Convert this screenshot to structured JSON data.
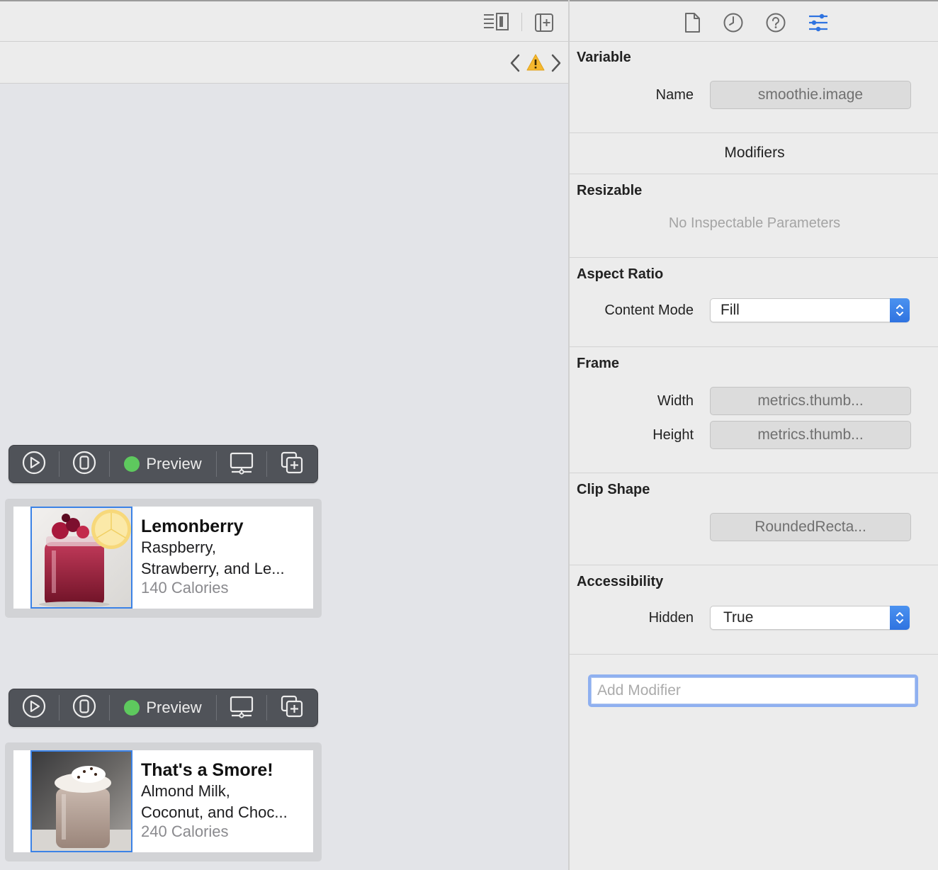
{
  "canvas": {
    "previews": [
      {
        "preview_label": "Preview",
        "title": "Lemonberry",
        "line1": "Raspberry,",
        "line2": "Strawberry, and Le...",
        "calories": "140 Calories"
      },
      {
        "preview_label": "Preview",
        "title": "That's a Smore!",
        "line1": "Almond Milk,",
        "line2": "Coconut, and Choc...",
        "calories": "240 Calories"
      }
    ]
  },
  "inspector": {
    "variable": {
      "title": "Variable",
      "name_label": "Name",
      "name_value": "smoothie.image"
    },
    "modifiers_header": "Modifiers",
    "resizable": {
      "title": "Resizable",
      "empty_text": "No Inspectable Parameters"
    },
    "aspect_ratio": {
      "title": "Aspect Ratio",
      "content_mode_label": "Content Mode",
      "content_mode_value": "Fill"
    },
    "frame": {
      "title": "Frame",
      "width_label": "Width",
      "width_value": "metrics.thumb...",
      "height_label": "Height",
      "height_value": "metrics.thumb..."
    },
    "clip_shape": {
      "title": "Clip Shape",
      "value": "RoundedRecta..."
    },
    "accessibility": {
      "title": "Accessibility",
      "hidden_label": "Hidden",
      "hidden_value": "True"
    },
    "add_modifier_placeholder": "Add Modifier"
  },
  "icons": {
    "toolbar": [
      "editor-options-icon",
      "add-editor-icon",
      "back-chevron-icon",
      "warning-icon",
      "forward-chevron-icon"
    ],
    "inspector_tabs": [
      "file-inspector-icon",
      "history-inspector-icon",
      "quick-help-icon",
      "attributes-inspector-icon"
    ],
    "preview_bar": [
      "live-preview-icon",
      "on-device-icon",
      "preview-settings-icon",
      "duplicate-preview-icon"
    ]
  },
  "colors": {
    "accent": "#2f73e0",
    "active_tab": "#2f73e0",
    "preview_dot": "#5ec95e",
    "warning": "#f5b82e"
  }
}
